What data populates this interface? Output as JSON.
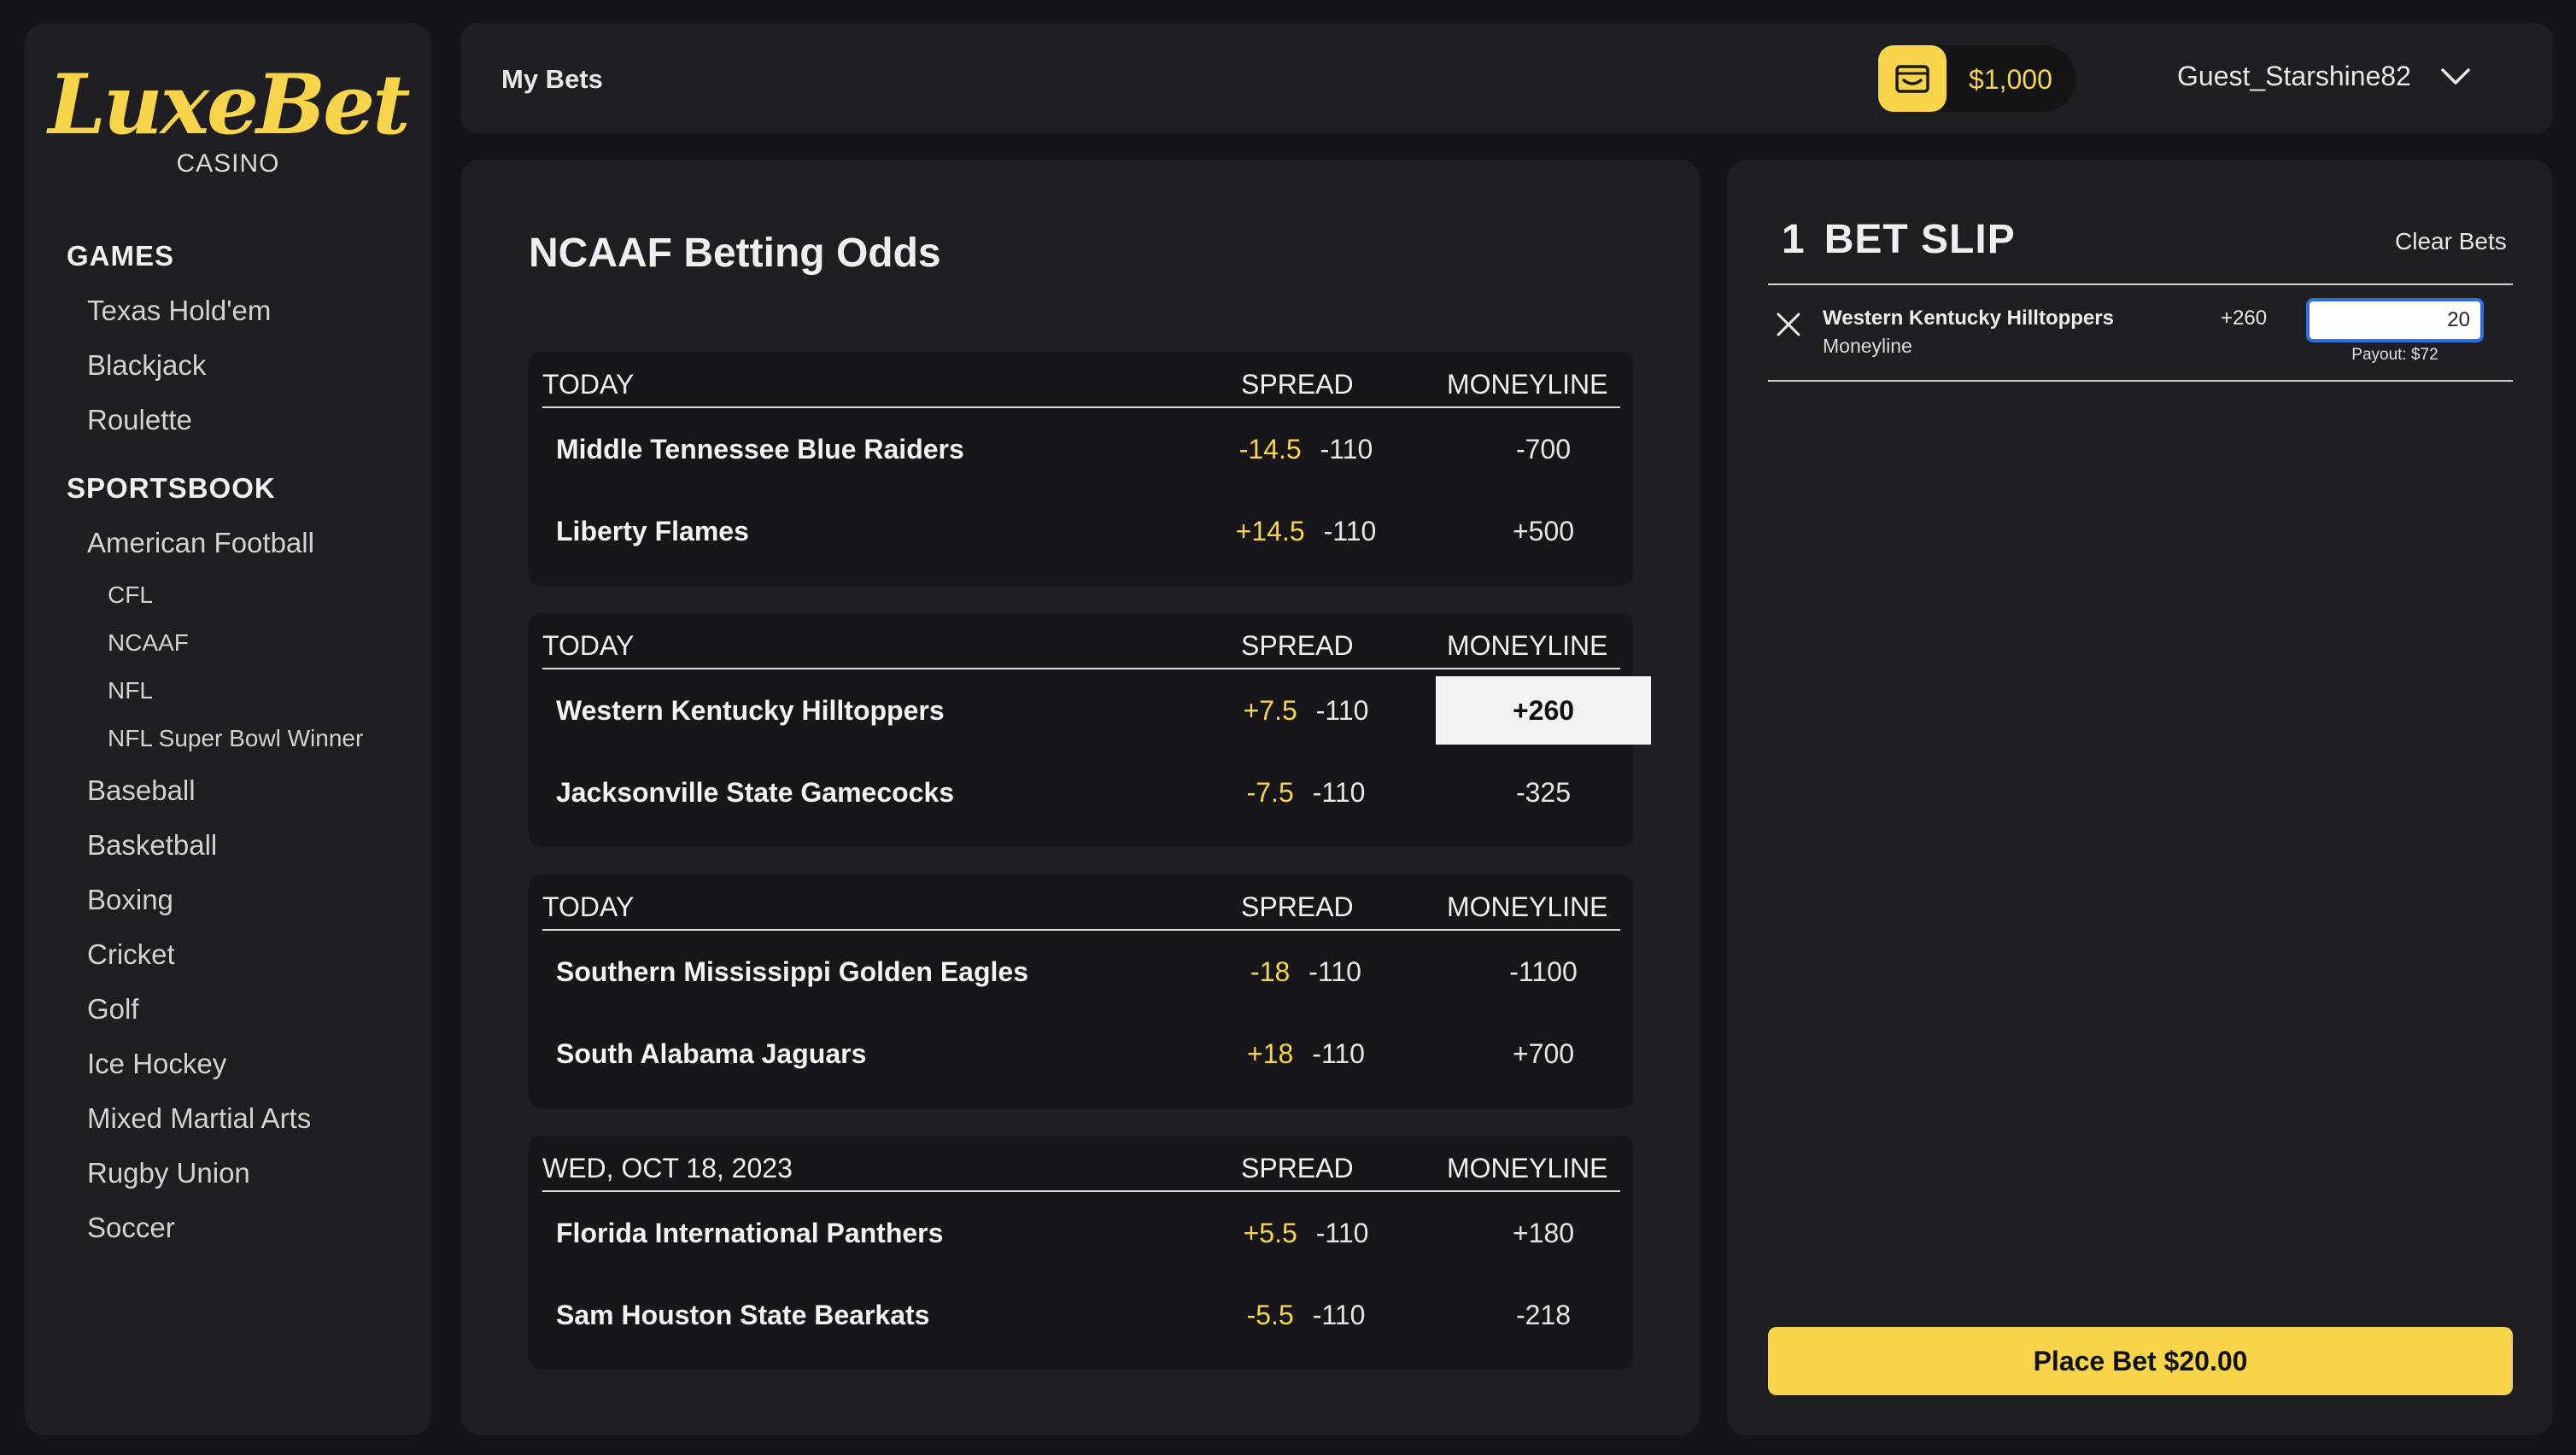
{
  "brand": {
    "name": "LuxeBet",
    "sub": "CASINO"
  },
  "colors": {
    "accent": "#f7d44a",
    "background": "#151519",
    "panel": "#1e1e23",
    "focus": "#2f6fe0"
  },
  "topbar": {
    "my_bets": "My Bets",
    "wallet_icon": "wallet-icon",
    "balance": "$1,000",
    "username": "Guest_Starshine82",
    "user_menu_icon": "chevron-down-icon"
  },
  "sidebar": {
    "games_heading": "GAMES",
    "games": [
      "Texas Hold'em",
      "Blackjack",
      "Roulette"
    ],
    "sportsbook_heading": "SPORTSBOOK",
    "american_football": "American Football",
    "football_subs": [
      "CFL",
      "NCAAF",
      "NFL",
      "NFL Super Bowl Winner"
    ],
    "sports": [
      "Baseball",
      "Basketball",
      "Boxing",
      "Cricket",
      "Golf",
      "Ice Hockey",
      "Mixed Martial Arts",
      "Rugby Union",
      "Soccer"
    ]
  },
  "main": {
    "title": "NCAAF Betting Odds",
    "col_spread": "SPREAD",
    "col_moneyline": "MONEYLINE",
    "games": [
      {
        "date": "TODAY",
        "teams": [
          {
            "name": "Middle Tennessee Blue Raiders",
            "spread": "-14.5",
            "juice": "-110",
            "moneyline": "-700"
          },
          {
            "name": "Liberty Flames",
            "spread": "+14.5",
            "juice": "-110",
            "moneyline": "+500"
          }
        ]
      },
      {
        "date": "TODAY",
        "teams": [
          {
            "name": "Western Kentucky Hilltoppers",
            "spread": "+7.5",
            "juice": "-110",
            "moneyline": "+260",
            "selected": true
          },
          {
            "name": "Jacksonville State Gamecocks",
            "spread": "-7.5",
            "juice": "-110",
            "moneyline": "-325"
          }
        ]
      },
      {
        "date": "TODAY",
        "teams": [
          {
            "name": "Southern Mississippi Golden Eagles",
            "spread": "-18",
            "juice": "-110",
            "moneyline": "-1100"
          },
          {
            "name": "South Alabama Jaguars",
            "spread": "+18",
            "juice": "-110",
            "moneyline": "+700"
          }
        ]
      },
      {
        "date": "WED, OCT 18, 2023",
        "teams": [
          {
            "name": "Florida International Panthers",
            "spread": "+5.5",
            "juice": "-110",
            "moneyline": "+180"
          },
          {
            "name": "Sam Houston State Bearkats",
            "spread": "-5.5",
            "juice": "-110",
            "moneyline": "-218"
          }
        ]
      }
    ]
  },
  "slip": {
    "count": "1",
    "title": "BET SLIP",
    "clear": "Clear Bets",
    "remove_icon": "close-icon",
    "bet": {
      "team": "Western Kentucky Hilltoppers",
      "type": "Moneyline",
      "odds": "+260",
      "stake": "20",
      "payout": "Payout: $72"
    },
    "place_label": "Place Bet $20.00"
  }
}
